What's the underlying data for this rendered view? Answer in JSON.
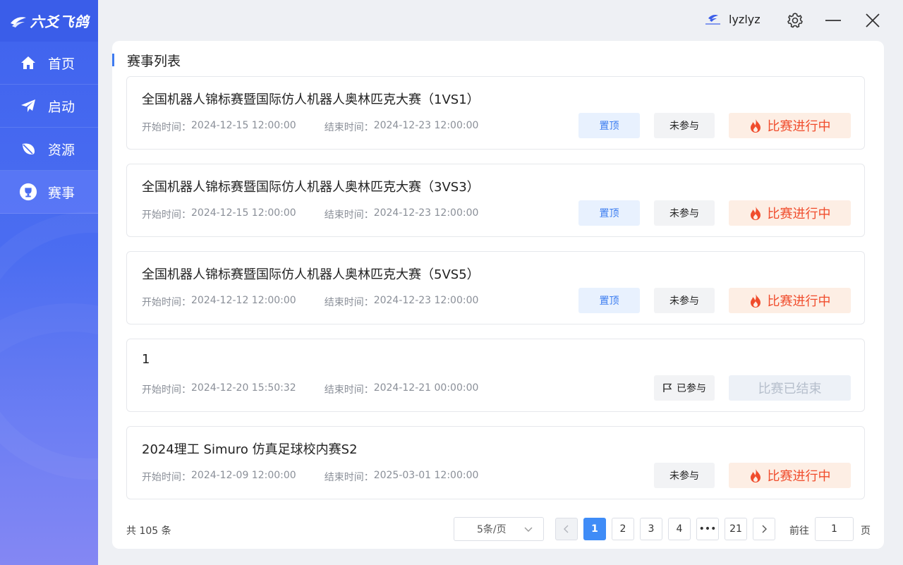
{
  "app": {
    "logo_text": "六爻飞鸽",
    "accent": "#3f63ee"
  },
  "nav": {
    "items": [
      {
        "label": "首页",
        "icon": "home-icon"
      },
      {
        "label": "启动",
        "icon": "paper-plane-icon"
      },
      {
        "label": "资源",
        "icon": "leaf-icon"
      },
      {
        "label": "赛事",
        "icon": "trophy-icon",
        "active": true
      }
    ]
  },
  "header": {
    "username": "lyzlyz"
  },
  "main": {
    "title": "赛事列表",
    "start_label": "开始时间：",
    "end_label": "结束时间：",
    "pin_label": "置顶",
    "events": [
      {
        "name": "全国机器人锦标赛暨国际仿人机器人奥林匹克大赛（1VS1）",
        "start": "2024-12-15 12:00:00",
        "end": "2024-12-23 12:00:00",
        "pinned": true,
        "join": "未参与",
        "status": "比赛进行中"
      },
      {
        "name": "全国机器人锦标赛暨国际仿人机器人奥林匹克大赛（3VS3）",
        "start": "2024-12-15 12:00:00",
        "end": "2024-12-23 12:00:00",
        "pinned": true,
        "join": "未参与",
        "status": "比赛进行中"
      },
      {
        "name": "全国机器人锦标赛暨国际仿人机器人奥林匹克大赛（5VS5）",
        "start": "2024-12-12 12:00:00",
        "end": "2024-12-23 12:00:00",
        "pinned": true,
        "join": "未参与",
        "status": "比赛进行中"
      },
      {
        "name": "1",
        "start": "2024-12-20 15:50:32",
        "end": "2024-12-21 00:00:00",
        "pinned": false,
        "join": "已参与",
        "status": "比赛已结束"
      },
      {
        "name": "2024理工 Simuro 仿真足球校内赛S2",
        "start": "2024-12-09 12:00:00",
        "end": "2025-03-01 12:00:00",
        "pinned": false,
        "join": "未参与",
        "status": "比赛进行中"
      }
    ]
  },
  "pagination": {
    "total": "共 105 条",
    "page_size": "5条/页",
    "pages": [
      "1",
      "2",
      "3",
      "4",
      "•••",
      "21"
    ],
    "current": "1",
    "goto_label": "前往",
    "goto_value": "1",
    "page_suffix": "页"
  }
}
